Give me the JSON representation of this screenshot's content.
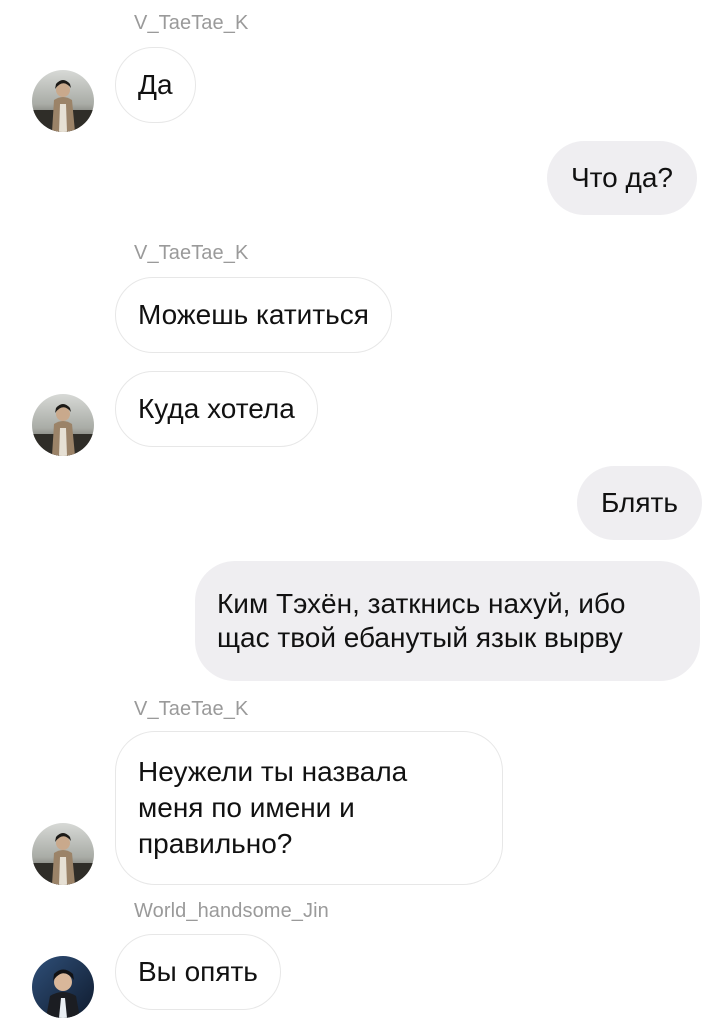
{
  "messages": [
    {
      "id": "m1",
      "sender": "V_TaeTae_K",
      "text": "Да"
    },
    {
      "id": "m2",
      "text": "Что да?"
    },
    {
      "id": "m3",
      "sender": "V_TaeTae_K",
      "text": "Можешь катиться"
    },
    {
      "id": "m4",
      "text": "Куда хотела"
    },
    {
      "id": "m5",
      "text": "Блять"
    },
    {
      "id": "m6",
      "lines": [
        "Ким Тэхён, заткнись нахуй, ибо",
        "щас твой ебанутый язык вырву"
      ]
    },
    {
      "id": "m7",
      "sender": "V_TaeTae_K",
      "lines": [
        "Неужели ты назвала",
        "меня по имени и",
        "правильно?"
      ]
    },
    {
      "id": "m8",
      "sender": "World_handsome_Jin",
      "text": "Вы опять"
    }
  ],
  "avatars": {
    "v": "avatar-v-taetae-k",
    "jin": "avatar-world-handsome-jin"
  },
  "colors": {
    "incoming_bubble": "#ffffff",
    "incoming_border": "#e7e7e7",
    "outgoing_bubble": "#efeef1",
    "sender_name": "#9a9a9a",
    "message_text": "#111111"
  }
}
